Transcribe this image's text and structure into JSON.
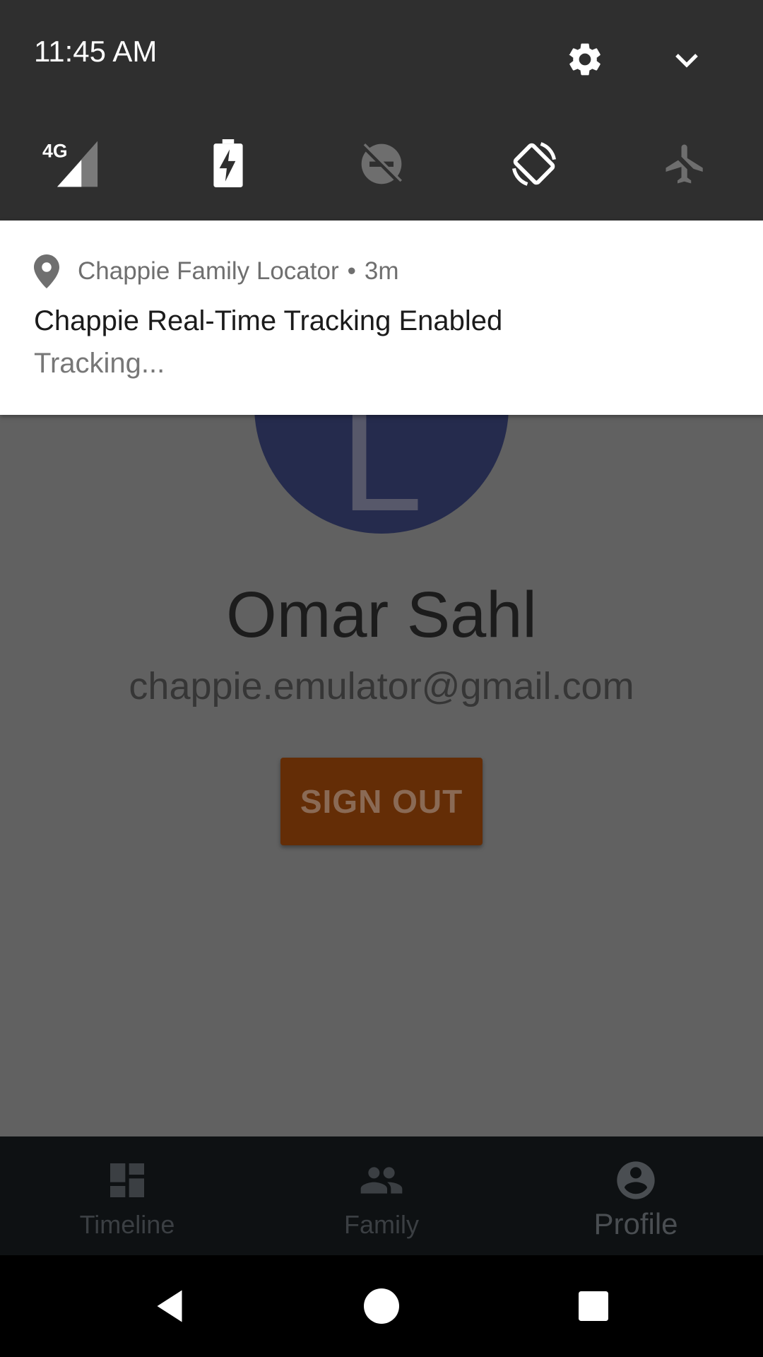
{
  "status_bar": {
    "time": "11:45 AM",
    "settings_icon": "gear-icon",
    "expand_icon": "chevron-down-icon"
  },
  "quick_settings": [
    {
      "name": "mobile-data",
      "icon": "signal-4g-icon",
      "label": "4G"
    },
    {
      "name": "battery-saver",
      "icon": "battery-charging-icon"
    },
    {
      "name": "do-not-disturb",
      "icon": "dnd-off-icon"
    },
    {
      "name": "auto-rotate",
      "icon": "rotate-icon"
    },
    {
      "name": "airplane-mode",
      "icon": "airplane-icon"
    }
  ],
  "notification": {
    "app_icon": "location-pin-icon",
    "app_name": "Chappie Family Locator",
    "separator": "•",
    "time_ago": "3m",
    "title": "Chappie Real-Time Tracking Enabled",
    "text": "Tracking..."
  },
  "profile": {
    "avatar_letter": "L",
    "name": "Omar Sahl",
    "email": "chappie.emulator@gmail.com",
    "sign_out_label": "SIGN OUT"
  },
  "bottom_nav": {
    "items": [
      {
        "label": "Timeline",
        "icon": "dashboard-icon"
      },
      {
        "label": "Family",
        "icon": "people-icon"
      },
      {
        "label": "Profile",
        "icon": "account-circle-icon",
        "active": true
      }
    ]
  },
  "system_nav": [
    "back-icon",
    "home-icon",
    "recents-icon"
  ],
  "colors": {
    "scrim_bg": "#616161",
    "avatar": "#252b4d",
    "sign_out": "#642d06",
    "shade": "#2f2f2f",
    "bottom_nav": "#0e1113"
  }
}
